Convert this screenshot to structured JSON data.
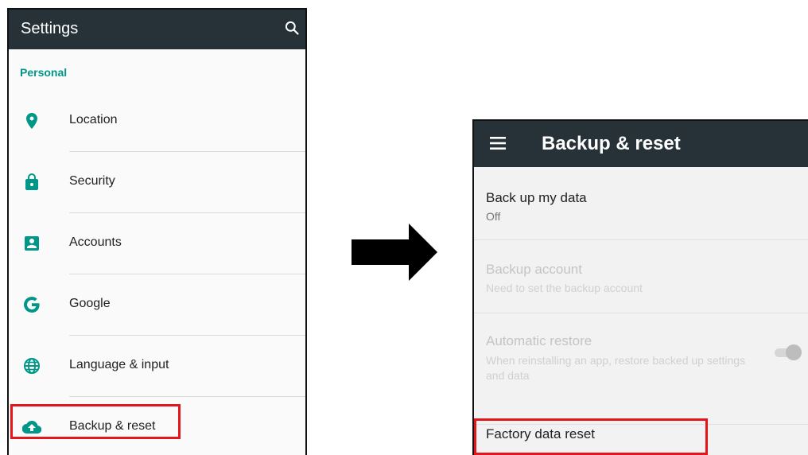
{
  "left_screen": {
    "toolbar": {
      "title": "Settings",
      "action_icon": "search-icon"
    },
    "section_header": "Personal",
    "items": [
      {
        "label": "Location",
        "icon": "location-pin-icon"
      },
      {
        "label": "Security",
        "icon": "lock-icon"
      },
      {
        "label": "Accounts",
        "icon": "account-box-icon"
      },
      {
        "label": "Google",
        "icon": "google-icon"
      },
      {
        "label": "Language & input",
        "icon": "globe-icon"
      },
      {
        "label": "Backup & reset",
        "icon": "cloud-upload-icon",
        "highlighted": true
      }
    ]
  },
  "arrow": {
    "icon": "right-arrow-icon"
  },
  "right_screen": {
    "toolbar": {
      "title": "Backup & reset",
      "nav_icon": "menu-icon"
    },
    "prefs": [
      {
        "title": "Back up my data",
        "summary": "Off",
        "enabled": true
      },
      {
        "title": "Backup account",
        "summary": "Need to set the backup account",
        "enabled": false
      },
      {
        "title": "Automatic restore",
        "summary": "When reinstalling an app, restore backed up settings and data",
        "enabled": false,
        "toggle": "on"
      },
      {
        "title": "Factory data reset",
        "summary": "",
        "enabled": true,
        "highlighted": true
      }
    ]
  },
  "colors": {
    "toolbar": "#263238",
    "accent": "#009688",
    "highlight": "#e3161b"
  }
}
